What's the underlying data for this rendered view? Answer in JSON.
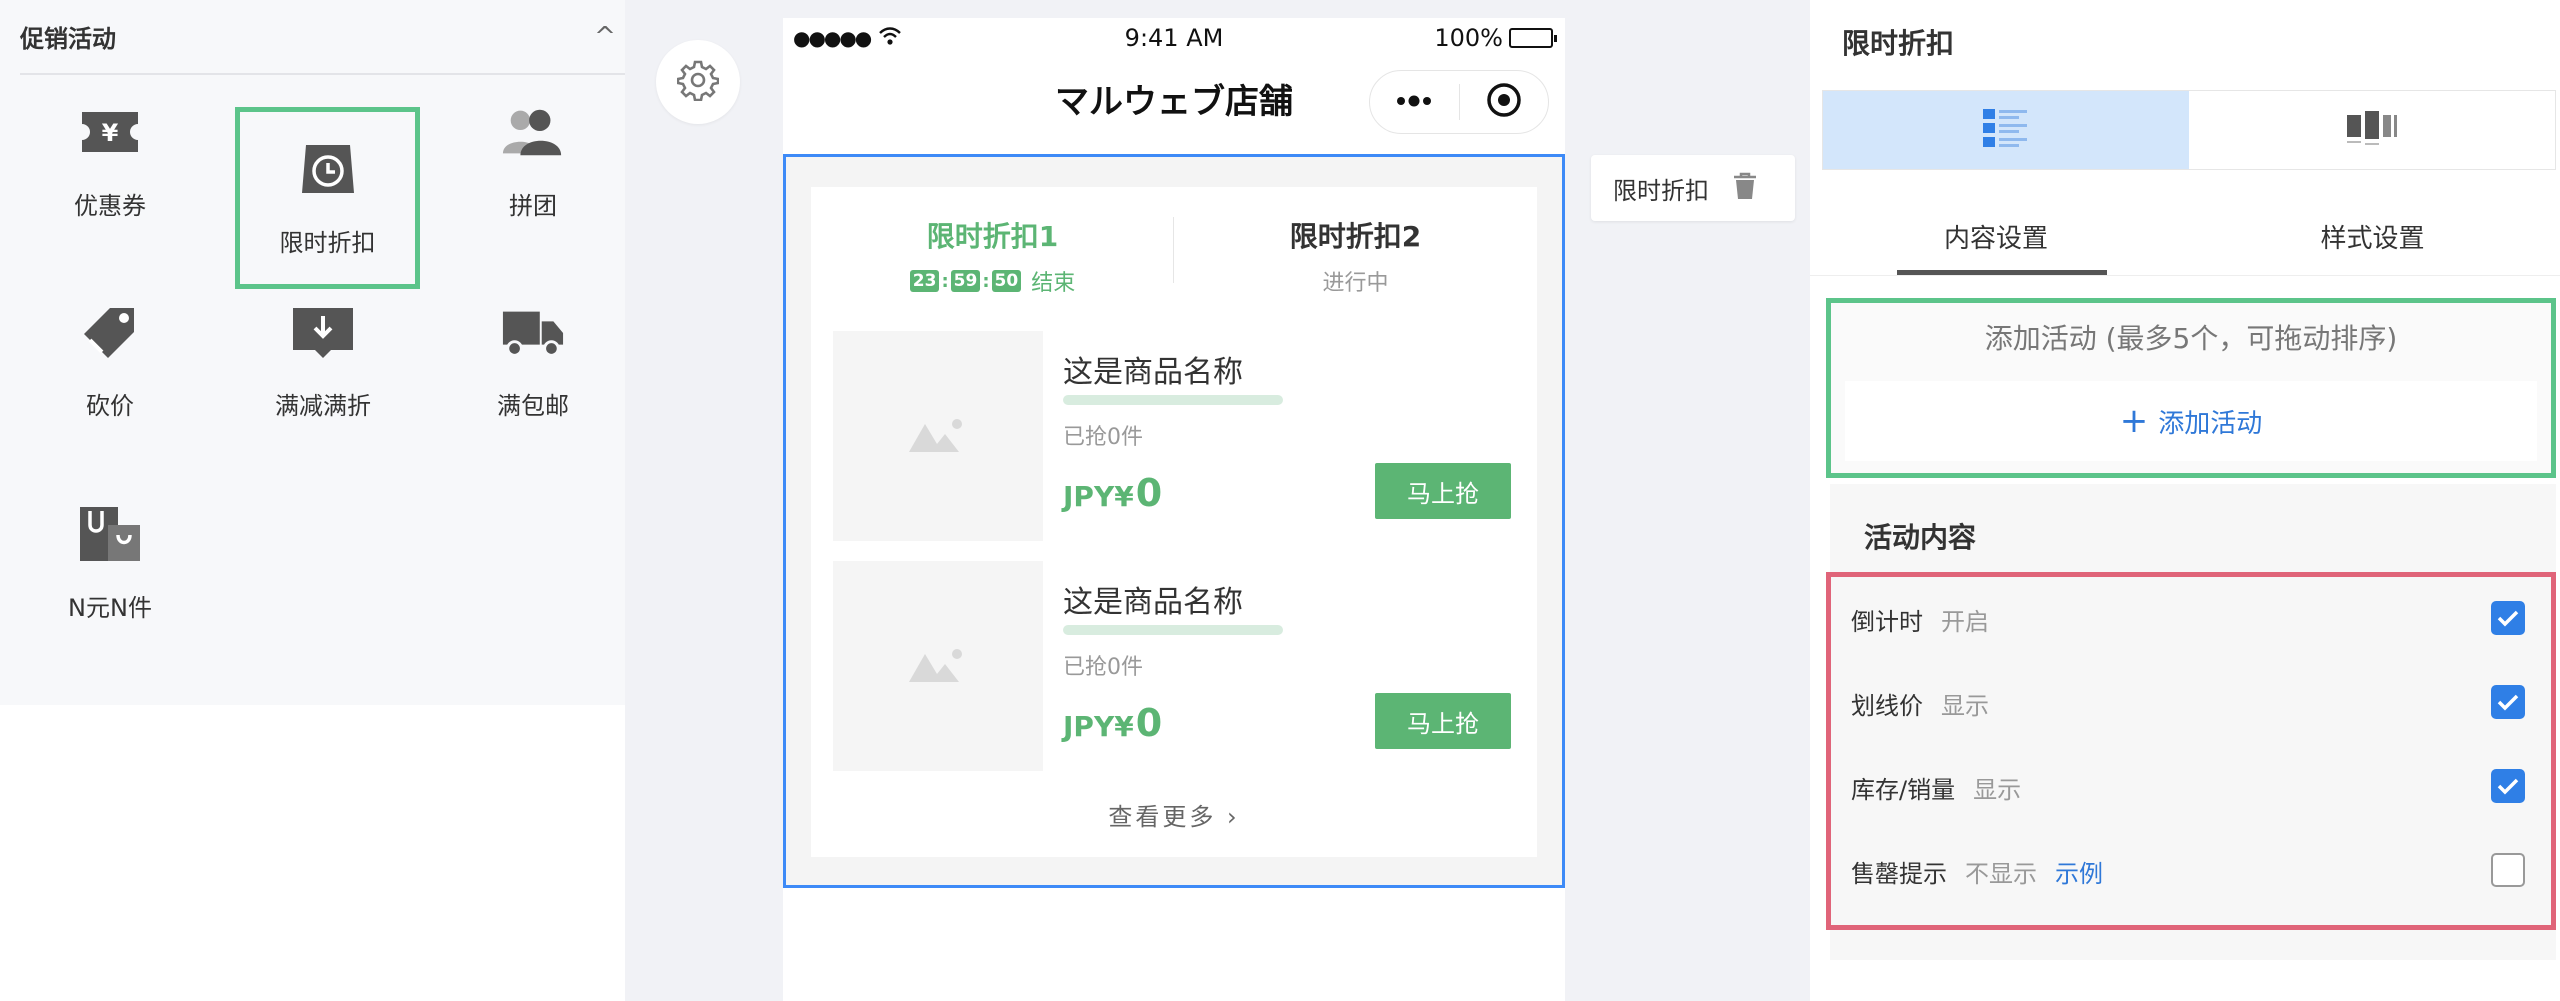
{
  "left_panel": {
    "title": "促销活动",
    "collapse_glyph": "^",
    "widgets": [
      {
        "label": "优惠券",
        "icon": "coupon-icon"
      },
      {
        "label": "限时折扣",
        "icon": "clock-icon",
        "selected": true
      },
      {
        "label": "拼团",
        "icon": "group-icon"
      },
      {
        "label": "砍价",
        "icon": "price-tag-icon"
      },
      {
        "label": "满减满折",
        "icon": "download-box-icon"
      },
      {
        "label": "满包邮",
        "icon": "truck-icon"
      },
      {
        "label": "N元N件",
        "icon": "shopping-bags-icon"
      }
    ]
  },
  "phone": {
    "status": {
      "time": "9:41 AM",
      "battery": "100%"
    },
    "nav_title": "マルウェブ店舗",
    "module": {
      "tabs": [
        {
          "title": "限时折扣1",
          "countdown": [
            "23",
            "59",
            "50"
          ],
          "status": "结束"
        },
        {
          "title": "限时折扣2",
          "status": "进行中"
        }
      ],
      "products": [
        {
          "name": "这是商品名称",
          "sold": "已抢0件",
          "currency": "JPY¥",
          "price": "0",
          "button": "马上抢"
        },
        {
          "name": "这是商品名称",
          "sold": "已抢0件",
          "currency": "JPY¥",
          "price": "0",
          "button": "马上抢"
        }
      ],
      "more": "查看更多 ›"
    }
  },
  "float_tag": {
    "label": "限时折扣",
    "icon": "trash-icon"
  },
  "right_panel": {
    "title": "限时折扣",
    "view_options": [
      {
        "icon": "list-layout-icon",
        "active": true
      },
      {
        "icon": "grid-layout-icon",
        "active": false
      }
    ],
    "tabs": [
      "内容设置",
      "样式设置"
    ],
    "add_hint": "添加活动 (最多5个，可拖动排序)",
    "add_button": "添加活动",
    "add_plus": "+",
    "content_title": "活动内容",
    "options": [
      {
        "label": "倒计时",
        "value": "开启",
        "checked": true
      },
      {
        "label": "划线价",
        "value": "显示",
        "checked": true
      },
      {
        "label": "库存/销量",
        "value": "显示",
        "checked": true
      },
      {
        "label": "售罄提示",
        "value": "不显示",
        "example": "示例",
        "checked": false
      }
    ]
  },
  "colors": {
    "accent_green": "#5cb574",
    "select_blue": "#3d8af7",
    "checkbox_blue": "#2f7fe6",
    "highlight_red": "#e06479",
    "link_blue": "#2f78d8"
  }
}
